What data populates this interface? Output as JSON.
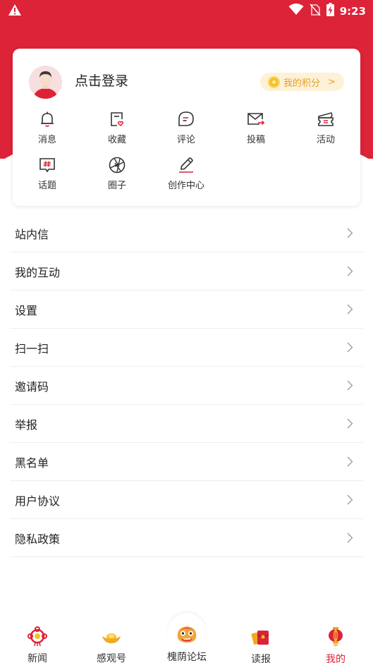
{
  "status_bar": {
    "time": "9:23",
    "icons": [
      "warning-icon",
      "wifi-icon",
      "no-sim-icon",
      "battery-charging-icon"
    ]
  },
  "profile": {
    "login_label": "点击登录",
    "points_label": "我的积分",
    "points_arrow": ">"
  },
  "quick_actions": [
    {
      "label": "消息",
      "icon": "bell-icon"
    },
    {
      "label": "收藏",
      "icon": "favorite-doc-icon"
    },
    {
      "label": "评论",
      "icon": "comment-icon"
    },
    {
      "label": "投稿",
      "icon": "mail-send-icon"
    },
    {
      "label": "活动",
      "icon": "ticket-icon"
    },
    {
      "label": "话题",
      "icon": "hashtag-icon"
    },
    {
      "label": "圈子",
      "icon": "aperture-icon"
    },
    {
      "label": "创作中心",
      "icon": "pencil-icon"
    }
  ],
  "menu": [
    {
      "label": "站内信"
    },
    {
      "label": "我的互动"
    },
    {
      "label": "设置"
    },
    {
      "label": "扫一扫"
    },
    {
      "label": "邀请码"
    },
    {
      "label": "举报"
    },
    {
      "label": "黑名单"
    },
    {
      "label": "用户协议"
    },
    {
      "label": "隐私政策"
    }
  ],
  "bottom_nav": [
    {
      "label": "新闻",
      "icon": "chinese-knot-icon",
      "active": false
    },
    {
      "label": "感观号",
      "icon": "gold-ingot-icon",
      "active": false
    },
    {
      "label": "槐荫论坛",
      "icon": "lion-dance-icon",
      "active": false
    },
    {
      "label": "读报",
      "icon": "red-envelope-icon",
      "active": false
    },
    {
      "label": "我的",
      "icon": "lantern-icon",
      "active": true
    }
  ],
  "colors": {
    "brand_red": "#dc2338",
    "gold": "#e1a22b",
    "text": "#222222",
    "divider": "#efefef"
  }
}
